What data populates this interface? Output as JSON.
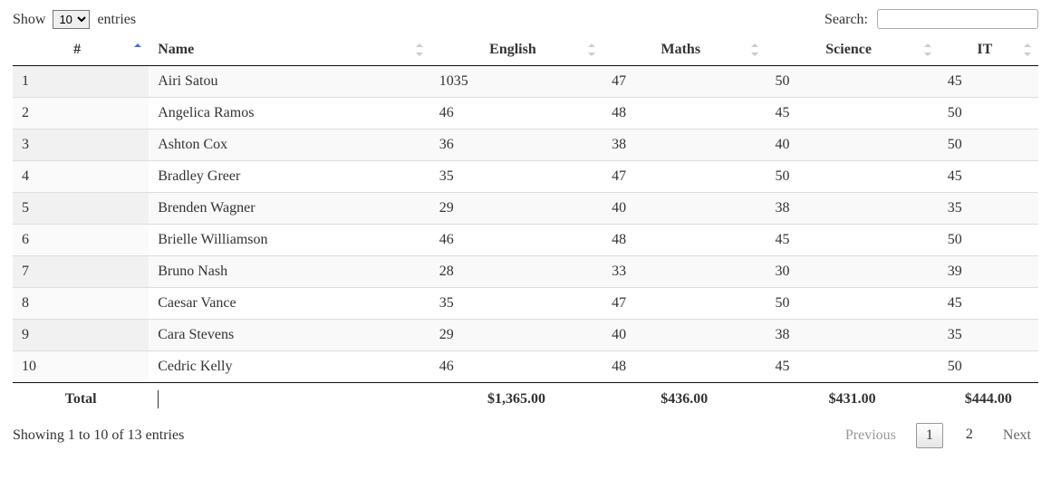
{
  "length": {
    "prefix": "Show",
    "suffix": "entries",
    "selected": "10",
    "options": [
      "10"
    ]
  },
  "search": {
    "label": "Search:",
    "value": ""
  },
  "columns": {
    "idx": "#",
    "name": "Name",
    "english": "English",
    "maths": "Maths",
    "science": "Science",
    "it": "IT"
  },
  "rows": [
    {
      "idx": "1",
      "name": "Airi Satou",
      "english": "1035",
      "maths": "47",
      "science": "50",
      "it": "45"
    },
    {
      "idx": "2",
      "name": "Angelica Ramos",
      "english": "46",
      "maths": "48",
      "science": "45",
      "it": "50"
    },
    {
      "idx": "3",
      "name": "Ashton Cox",
      "english": "36",
      "maths": "38",
      "science": "40",
      "it": "50"
    },
    {
      "idx": "4",
      "name": "Bradley Greer",
      "english": "35",
      "maths": "47",
      "science": "50",
      "it": "45"
    },
    {
      "idx": "5",
      "name": "Brenden Wagner",
      "english": "29",
      "maths": "40",
      "science": "38",
      "it": "35"
    },
    {
      "idx": "6",
      "name": "Brielle Williamson",
      "english": "46",
      "maths": "48",
      "science": "45",
      "it": "50"
    },
    {
      "idx": "7",
      "name": "Bruno Nash",
      "english": "28",
      "maths": "33",
      "science": "30",
      "it": "39"
    },
    {
      "idx": "8",
      "name": "Caesar Vance",
      "english": "35",
      "maths": "47",
      "science": "50",
      "it": "45"
    },
    {
      "idx": "9",
      "name": "Cara Stevens",
      "english": "29",
      "maths": "40",
      "science": "38",
      "it": "35"
    },
    {
      "idx": "10",
      "name": "Cedric Kelly",
      "english": "46",
      "maths": "48",
      "science": "45",
      "it": "50"
    }
  ],
  "footer": {
    "total_label": "Total",
    "english": "$1,365.00",
    "maths": "$436.00",
    "science": "$431.00",
    "it": "$444.00"
  },
  "info": "Showing 1 to 10 of 13 entries",
  "pagination": {
    "previous": "Previous",
    "next": "Next",
    "pages": [
      "1",
      "2"
    ],
    "current": "1"
  }
}
